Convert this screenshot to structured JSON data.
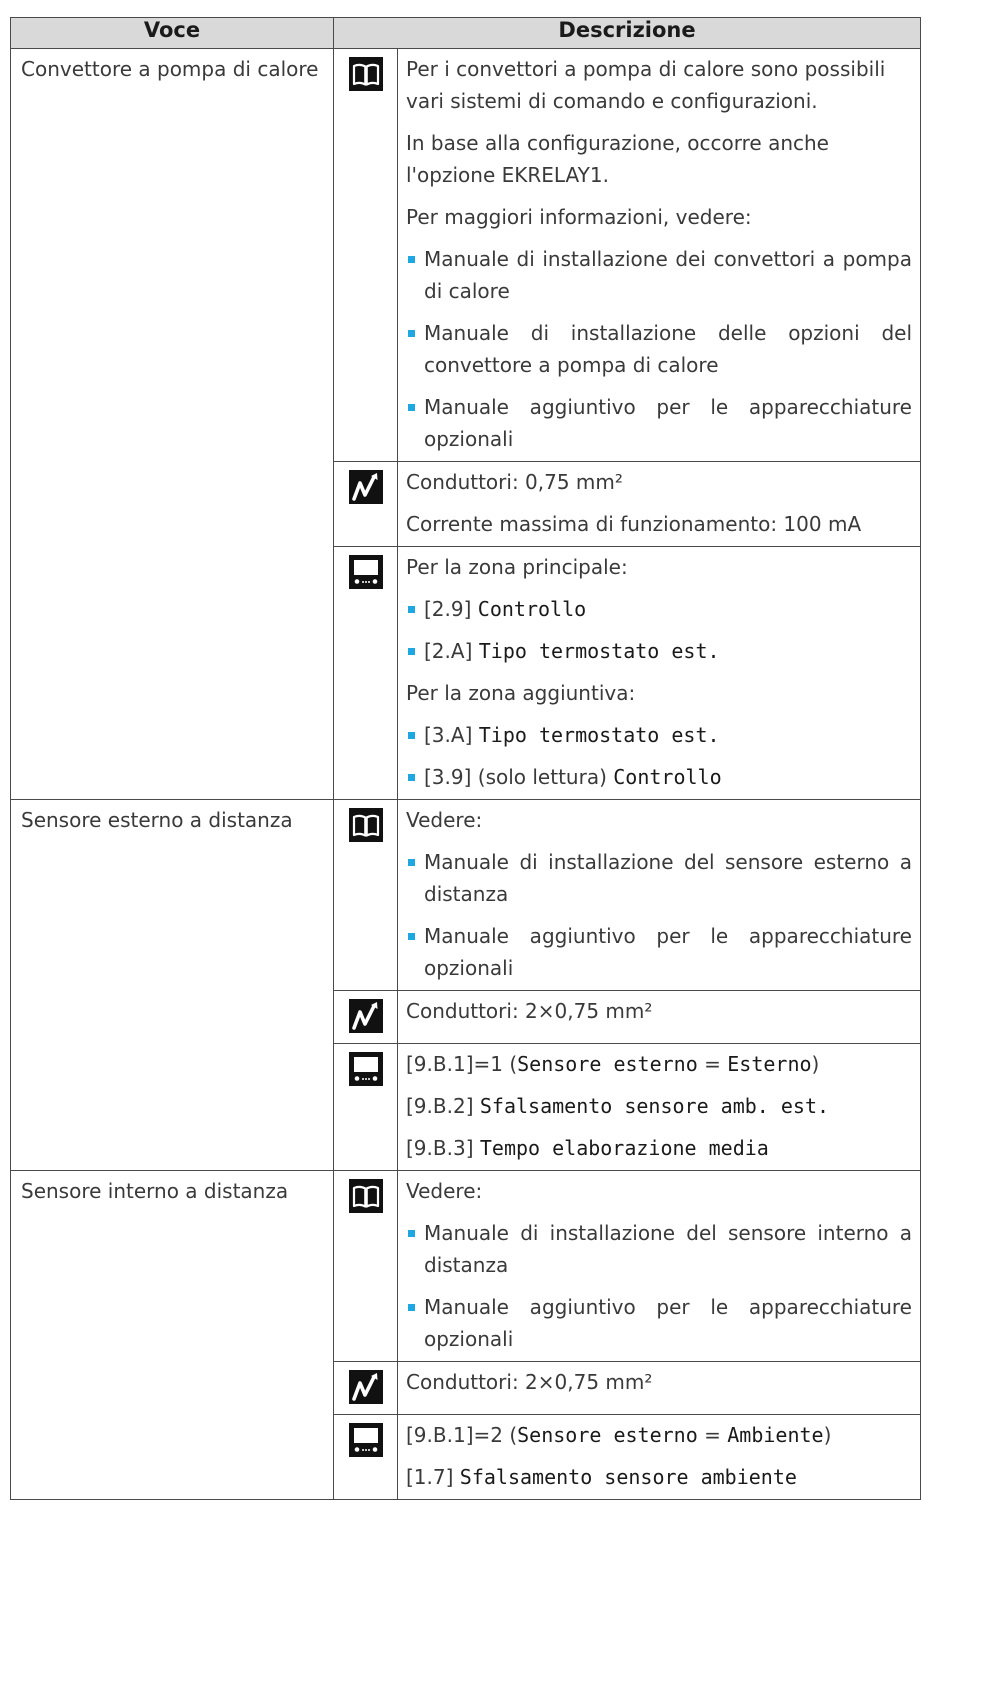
{
  "table": {
    "headers": {
      "voce": "Voce",
      "descrizione": "Descrizione"
    },
    "rows": [
      {
        "voce": "Convettore a pompa di calore",
        "blocks": [
          {
            "icon": "manual-book-icon",
            "paragraphs": [
              "Per i convettori a pompa di calore sono possibili vari sistemi di comando e configurazioni.",
              "In base alla configurazione, occorre anche l'opzione EKRELAY1.",
              "Per maggiori informazioni, vedere:"
            ],
            "bullets": [
              "Manuale di installazione dei convettori a pompa di calore",
              "Manuale di installazione delle opzioni del convettore a pompa di calore",
              "Manuale aggiuntivo per le apparecchiature opzionali"
            ]
          },
          {
            "icon": "wire-icon",
            "paragraphs": [
              "Conduttori: 0,75 mm²",
              "Corrente massima di funzionamento: 100 mA"
            ]
          },
          {
            "icon": "user-interface-icon",
            "main_zone_label": "Per la zona principale:",
            "main_zone_items": [
              {
                "code": "[2.9]",
                "name": "Controllo"
              },
              {
                "code": "[2.A]",
                "name": "Tipo termostato est."
              }
            ],
            "additional_zone_label": "Per la zona aggiuntiva:",
            "additional_zone_items": [
              {
                "code": "[3.A]",
                "name": "Tipo termostato est."
              },
              {
                "code": "[3.9] (solo lettura)",
                "name": "Controllo"
              }
            ]
          }
        ]
      },
      {
        "voce": "Sensore esterno a distanza",
        "blocks": [
          {
            "icon": "manual-book-icon",
            "paragraphs": [
              "Vedere:"
            ],
            "bullets": [
              "Manuale di installazione del sensore esterno a distanza",
              "Manuale aggiuntivo per le apparecchiature opzionali"
            ]
          },
          {
            "icon": "wire-icon",
            "paragraphs": [
              "Conduttori: 2×0,75 mm²"
            ]
          },
          {
            "icon": "user-interface-icon",
            "settings": [
              {
                "code": "[9.B.1]=1 (",
                "name": "Sensore esterno",
                "eq": " = ",
                "value": "Esterno",
                "close": ")"
              },
              {
                "code": "[9.B.2] ",
                "name": "Sfalsamento sensore amb. est."
              },
              {
                "code": "[9.B.3] ",
                "name": "Tempo elaborazione media"
              }
            ]
          }
        ]
      },
      {
        "voce": "Sensore interno a distanza",
        "blocks": [
          {
            "icon": "manual-book-icon",
            "paragraphs": [
              "Vedere:"
            ],
            "bullets": [
              "Manuale di installazione del sensore interno a distanza",
              "Manuale aggiuntivo per le apparecchiature opzionali"
            ]
          },
          {
            "icon": "wire-icon",
            "paragraphs": [
              "Conduttori: 2×0,75 mm²"
            ]
          },
          {
            "icon": "user-interface-icon",
            "settings": [
              {
                "code": "[9.B.1]=2 (",
                "name": "Sensore esterno",
                "eq": " = ",
                "value": "Ambiente",
                "close": ")"
              },
              {
                "code": "[1.7] ",
                "name": "Sfalsamento sensore ambiente"
              }
            ]
          }
        ]
      }
    ]
  }
}
